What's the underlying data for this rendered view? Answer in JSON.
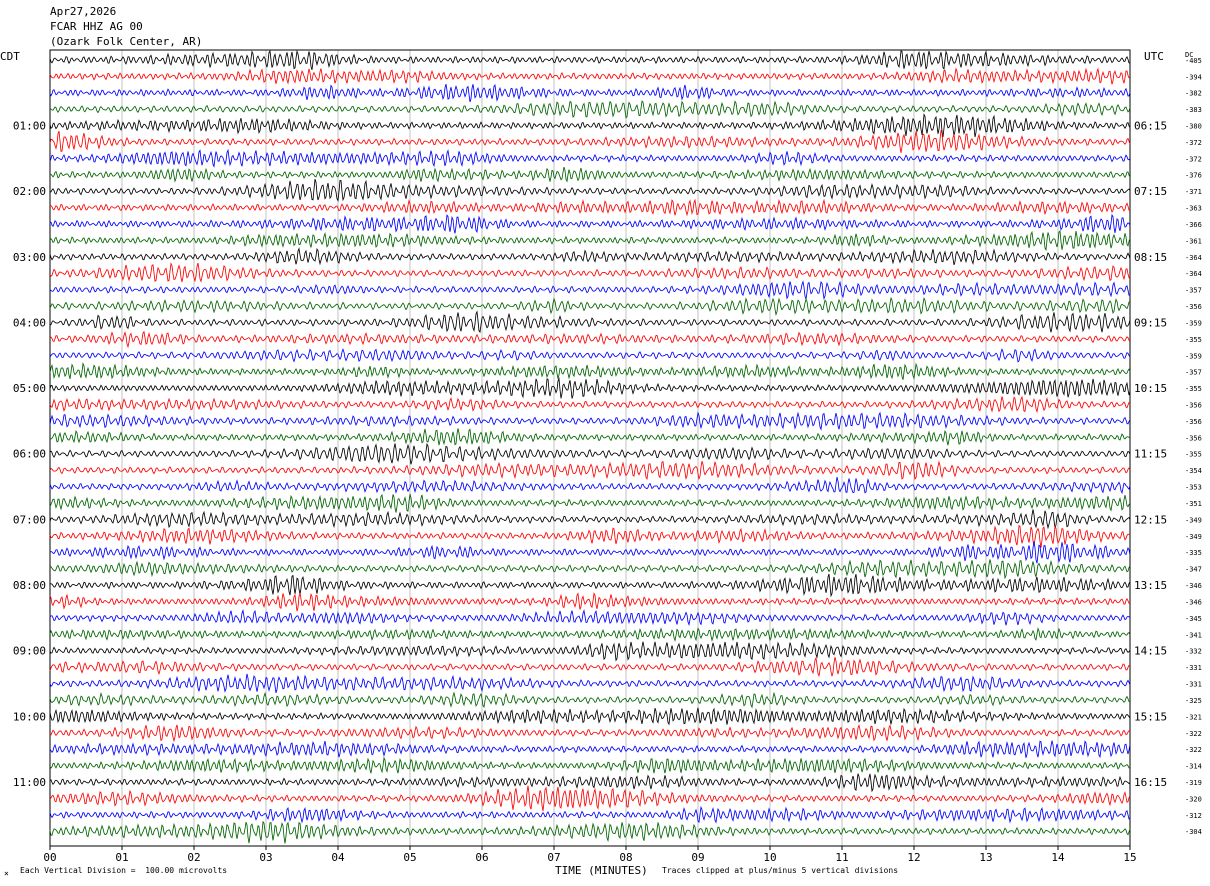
{
  "header": {
    "date": "Apr27,2026",
    "station": "FCAR HHZ AG 00",
    "location": "(Ozark Folk Center, AR)"
  },
  "left_tz": "CDT",
  "right_tz": "UTC",
  "dc_label": "DC",
  "footer": {
    "scale_note": "Each Vertical Division =  100.00 microvolts",
    "clip_note": "Traces clipped at plus/minus 5 vertical divisions",
    "corner_mark": "×"
  },
  "chart_data": {
    "type": "line",
    "title": "",
    "xlabel": "TIME (MINUTES)",
    "ylabel": "",
    "x_ticks": [
      "00",
      "01",
      "02",
      "03",
      "04",
      "05",
      "06",
      "07",
      "08",
      "09",
      "10",
      "11",
      "12",
      "13",
      "14",
      "15"
    ],
    "xlim": [
      0,
      15
    ],
    "grid": true,
    "trace_colors": [
      "#000000",
      "#ff0000",
      "#0000ff",
      "#006400"
    ],
    "left_hour_labels": [
      "01:00",
      "02:00",
      "03:00",
      "04:00",
      "05:00",
      "06:00",
      "07:00",
      "08:00",
      "09:00",
      "10:00",
      "11:00"
    ],
    "right_hour_labels": [
      "06:15",
      "07:15",
      "08:15",
      "09:15",
      "10:15",
      "11:15",
      "12:15",
      "13:15",
      "14:15",
      "15:15",
      "16:15"
    ],
    "dc_offsets": [
      -405,
      -394,
      -382,
      -383,
      -380,
      -372,
      -372,
      -376,
      -371,
      -363,
      -366,
      -361,
      -364,
      -364,
      -357,
      -356,
      -359,
      -355,
      -359,
      -357,
      -355,
      -356,
      -356,
      -356,
      -355,
      -354,
      -353,
      -351,
      -349,
      -349,
      -335,
      -347,
      -346,
      -346,
      -345,
      -341,
      -332,
      -331,
      -331,
      -325,
      -321,
      -322,
      -322,
      -314,
      -319,
      -320,
      -312,
      -304
    ]
  }
}
